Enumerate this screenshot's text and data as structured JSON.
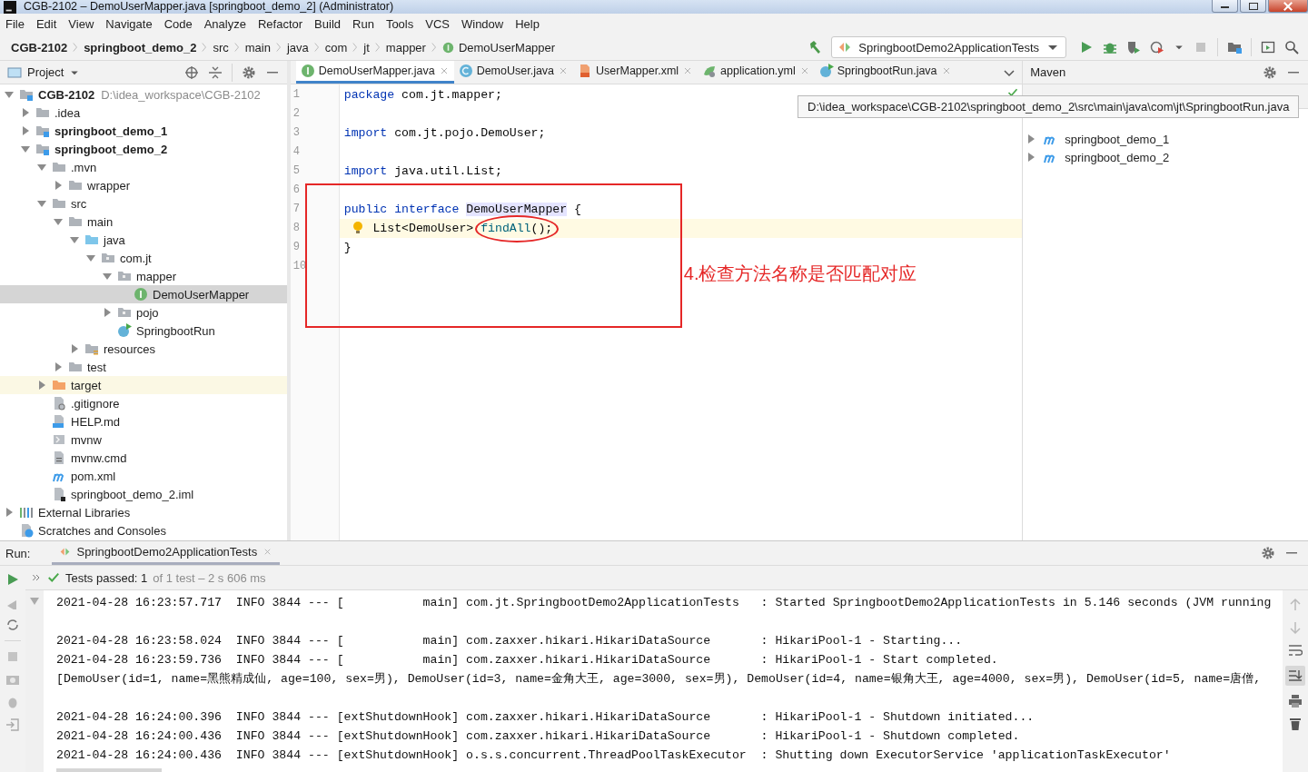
{
  "window": {
    "title": "CGB-2102 – DemoUserMapper.java [springboot_demo_2] (Administrator)"
  },
  "menu": [
    "File",
    "Edit",
    "View",
    "Navigate",
    "Code",
    "Analyze",
    "Refactor",
    "Build",
    "Run",
    "Tools",
    "VCS",
    "Window",
    "Help"
  ],
  "breadcrumbs": [
    {
      "label": "CGB-2102",
      "kind": "project"
    },
    {
      "label": "springboot_demo_2",
      "kind": "module"
    },
    {
      "label": "src",
      "kind": "folder"
    },
    {
      "label": "main",
      "kind": "folder"
    },
    {
      "label": "java",
      "kind": "folder"
    },
    {
      "label": "com",
      "kind": "folder"
    },
    {
      "label": "jt",
      "kind": "folder"
    },
    {
      "label": "mapper",
      "kind": "folder"
    },
    {
      "label": "DemoUserMapper",
      "kind": "interface"
    }
  ],
  "run_config": {
    "label": "SpringbootDemo2ApplicationTests"
  },
  "project_panel": {
    "title": "Project"
  },
  "tree": [
    {
      "label": "CGB-2102",
      "kind": "module",
      "path": "D:\\idea_workspace\\CGB-2102",
      "expanded": true,
      "selected": false,
      "children": [
        {
          "label": ".idea",
          "kind": "folder",
          "expanded": false,
          "selected": false
        },
        {
          "label": "springboot_demo_1",
          "kind": "module",
          "expanded": false,
          "selected": false
        },
        {
          "label": "springboot_demo_2",
          "kind": "module",
          "expanded": true,
          "selected": false,
          "children": [
            {
              "label": ".mvn",
              "kind": "folder",
              "expanded": true,
              "selected": false,
              "children": [
                {
                  "label": "wrapper",
                  "kind": "folder",
                  "expanded": false,
                  "selected": false
                }
              ]
            },
            {
              "label": "src",
              "kind": "folder",
              "expanded": true,
              "selected": false,
              "children": [
                {
                  "label": "main",
                  "kind": "folder",
                  "expanded": true,
                  "selected": false,
                  "children": [
                    {
                      "label": "java",
                      "kind": "source",
                      "expanded": true,
                      "selected": false,
                      "children": [
                        {
                          "label": "com.jt",
                          "kind": "package",
                          "expanded": true,
                          "selected": false,
                          "children": [
                            {
                              "label": "mapper",
                              "kind": "package",
                              "expanded": true,
                              "selected": false,
                              "children": [
                                {
                                  "label": "DemoUserMapper",
                                  "kind": "interface",
                                  "selected": true
                                }
                              ]
                            },
                            {
                              "label": "pojo",
                              "kind": "package",
                              "expanded": false,
                              "selected": false
                            },
                            {
                              "label": "SpringbootRun",
                              "kind": "run-class",
                              "selected": false
                            }
                          ]
                        }
                      ]
                    },
                    {
                      "label": "resources",
                      "kind": "resources",
                      "expanded": false,
                      "selected": false
                    }
                  ]
                },
                {
                  "label": "test",
                  "kind": "folder",
                  "expanded": false,
                  "selected": false
                }
              ]
            },
            {
              "label": "target",
              "kind": "excluded",
              "expanded": false,
              "selected": false
            },
            {
              "label": ".gitignore",
              "kind": "gitignore",
              "selected": false
            },
            {
              "label": "HELP.md",
              "kind": "markdown",
              "selected": false
            },
            {
              "label": "mvnw",
              "kind": "script",
              "selected": false
            },
            {
              "label": "mvnw.cmd",
              "kind": "text-file",
              "selected": false
            },
            {
              "label": "pom.xml",
              "kind": "maven",
              "selected": false
            },
            {
              "label": "springboot_demo_2.iml",
              "kind": "iml",
              "selected": false
            }
          ]
        }
      ]
    },
    {
      "label": "External Libraries",
      "kind": "libraries",
      "expanded": false,
      "selected": false
    },
    {
      "label": "Scratches and Consoles",
      "kind": "scratches",
      "selected": false
    }
  ],
  "editor_tabs": [
    {
      "label": "DemoUserMapper.java",
      "kind": "interface",
      "selected": true
    },
    {
      "label": "DemoUser.java",
      "kind": "class",
      "selected": false
    },
    {
      "label": "UserMapper.xml",
      "kind": "xml",
      "selected": false
    },
    {
      "label": "application.yml",
      "kind": "yaml",
      "selected": false
    },
    {
      "label": "SpringbootRun.java",
      "kind": "run-class",
      "selected": false
    }
  ],
  "code_lines": [
    {
      "n": "1",
      "tokens": [
        {
          "kind": "keyword",
          "text": "package"
        },
        {
          "kind": "plain",
          "text": " com.jt.mapper;"
        }
      ]
    },
    {
      "n": "2"
    },
    {
      "n": "3",
      "tokens": [
        {
          "kind": "keyword",
          "text": "import"
        },
        {
          "kind": "plain",
          "text": " com.jt.pojo.DemoUser;"
        }
      ]
    },
    {
      "n": "4"
    },
    {
      "n": "5",
      "tokens": [
        {
          "kind": "keyword",
          "text": "import"
        },
        {
          "kind": "plain",
          "text": " java.util.List;"
        }
      ]
    },
    {
      "n": "6"
    },
    {
      "n": "7",
      "tokens": [
        {
          "kind": "keyword",
          "text": "public interface "
        },
        {
          "kind": "highlight",
          "text": "DemoUserMapper"
        },
        {
          "kind": "plain",
          "text": " {"
        }
      ]
    },
    {
      "n": "8",
      "current": true,
      "intention": true,
      "indented": true,
      "tokens": [
        {
          "kind": "plain",
          "text": "List<DemoUser> "
        },
        {
          "kind": "method",
          "text": "findAll"
        },
        {
          "kind": "plain",
          "text": "();"
        }
      ]
    },
    {
      "n": "9",
      "tokens": [
        {
          "kind": "plain",
          "text": "}"
        }
      ]
    },
    {
      "n": "10"
    }
  ],
  "annotation": {
    "text": "4.检查方法名称是否匹配对应"
  },
  "tooltip": {
    "text": "D:\\idea_workspace\\CGB-2102\\springboot_demo_2\\src\\main\\java\\com\\jt\\SpringbootRun.java"
  },
  "maven": {
    "title": "Maven",
    "items": [
      {
        "label": "springboot_demo_1",
        "expanded": false
      },
      {
        "label": "springboot_demo_2",
        "expanded": false
      }
    ]
  },
  "run_panel": {
    "label": "Run:",
    "tab": "SpringbootDemo2ApplicationTests",
    "status": "Tests passed: 1",
    "status_detail": "of 1 test – 2 s 606 ms",
    "console": [
      {
        "text": "2021-04-28 16:23:57.717  INFO 3844 --- [           main] com.jt.SpringbootDemo2ApplicationTests   : Started SpringbootDemo2ApplicationTests in 5.146 seconds (JVM running"
      },
      {
        "text": "2021-04-28 16:23:58.024  INFO 3844 --- [           main] com.zaxxer.hikari.HikariDataSource       : HikariPool-1 - Starting...",
        "blank_before": true
      },
      {
        "text": "2021-04-28 16:23:59.736  INFO 3844 --- [           main] com.zaxxer.hikari.HikariDataSource       : HikariPool-1 - Start completed."
      },
      {
        "text": "[DemoUser(id=1, name=黑熊精成仙, age=100, sex=男), DemoUser(id=3, name=金角大王, age=3000, sex=男), DemoUser(id=4, name=银角大王, age=4000, sex=男), DemoUser(id=5, name=唐僧,"
      },
      {
        "text": "2021-04-28 16:24:00.396  INFO 3844 --- [extShutdownHook] com.zaxxer.hikari.HikariDataSource       : HikariPool-1 - Shutdown initiated...",
        "blank_before": true
      },
      {
        "text": "2021-04-28 16:24:00.436  INFO 3844 --- [extShutdownHook] com.zaxxer.hikari.HikariDataSource       : HikariPool-1 - Shutdown completed."
      },
      {
        "text": "2021-04-28 16:24:00.436  INFO 3844 --- [extShutdownHook] o.s.s.concurrent.ThreadPoolTaskExecutor  : Shutting down ExecutorService 'applicationTaskExecutor'"
      }
    ]
  }
}
